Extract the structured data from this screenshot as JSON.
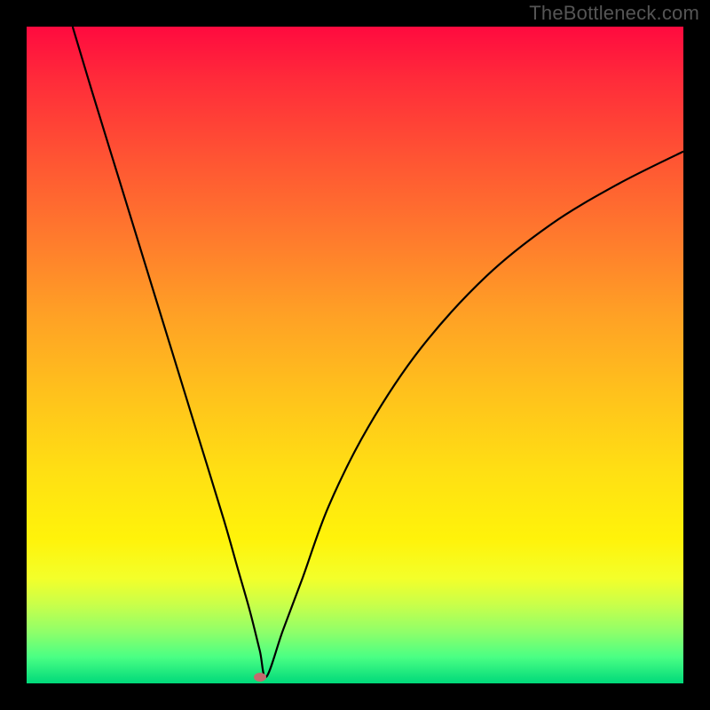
{
  "watermark": "TheBottleneck.com",
  "chart_data": {
    "type": "line",
    "title": "",
    "xlabel": "",
    "ylabel": "",
    "xlim": [
      0,
      100
    ],
    "ylim": [
      0,
      100
    ],
    "grid": false,
    "legend": false,
    "series": [
      {
        "name": "bottleneck-curve",
        "x_percent_of_width": [
          7,
          10,
          14,
          18,
          22,
          26,
          30,
          32,
          34,
          35.5,
          36.5,
          39,
          42,
          46,
          52,
          60,
          70,
          80,
          90,
          100
        ],
        "y_percent_of_height": [
          0,
          10,
          23,
          36,
          49,
          62,
          75,
          82,
          89,
          95,
          99,
          92,
          84,
          73,
          61,
          49,
          38,
          30,
          24,
          19
        ]
      }
    ],
    "min_point": {
      "x_percent_of_width": 35.5,
      "y_percent_of_height": 99
    },
    "colors": {
      "top": "#ff0a3f",
      "mid": "#ffe013",
      "bottom": "#00d97a",
      "curve": "#000000",
      "dot": "#c46a6e",
      "frame": "#000000"
    }
  }
}
